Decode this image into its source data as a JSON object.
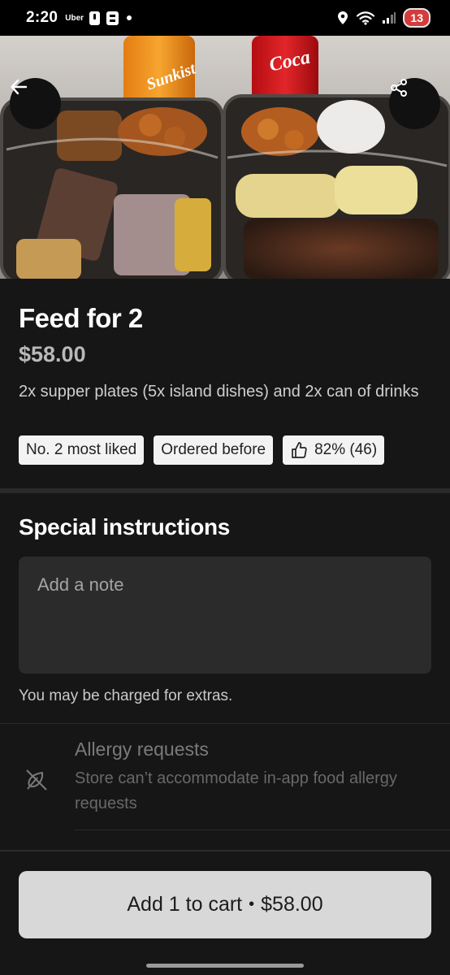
{
  "status_bar": {
    "time": "2:20",
    "app_label": "Uber",
    "battery": "13"
  },
  "hero": {
    "can_left_text": "Sunkist",
    "can_right_text": "Coca"
  },
  "item": {
    "title": "Feed for 2",
    "price": "$58.00",
    "description": "2x supper plates (5x island dishes) and 2x can of drinks",
    "badges": {
      "rank": "No. 2 most liked",
      "ordered": "Ordered before",
      "rating": "82% (46)"
    }
  },
  "special_instructions": {
    "heading": "Special instructions",
    "note_placeholder": "Add a note",
    "note_value": "",
    "extras_text": "You may be charged for extras."
  },
  "allergy": {
    "title": "Allergy requests",
    "subtitle": "Store can’t accommodate in-app food allergy requests"
  },
  "action": {
    "add_label": "Add 1 to cart",
    "separator": "•",
    "price": "$58.00"
  },
  "icons": {
    "back": "arrow-left-icon",
    "share": "share-icon",
    "thumbs": "thumbs-up-icon",
    "allergy": "allergy-icon"
  },
  "colors": {
    "background": "#161616",
    "button": "#d8d8d8",
    "badge": "#f3f3f3"
  }
}
